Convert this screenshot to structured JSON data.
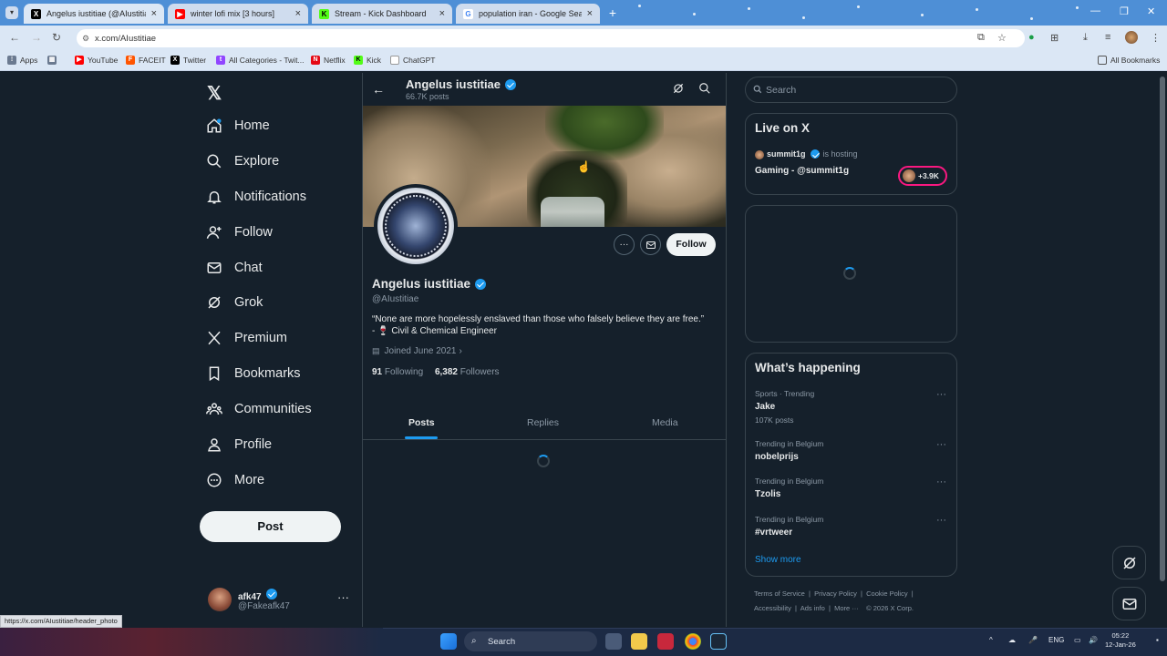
{
  "browser": {
    "tabs": [
      {
        "title": "Angelus iustitiae (@AIustitiae) /",
        "favicon": "x-logo-icon",
        "active": true
      },
      {
        "title": "winter lofi mix [3 hours] ",
        "favicon": "youtube-icon",
        "active": false
      },
      {
        "title": "Stream - Kick Dashboard",
        "favicon": "kick-icon",
        "active": false
      },
      {
        "title": "population iran - Google Searc",
        "favicon": "google-icon",
        "active": false
      }
    ],
    "url": "x.com/AIustitiae",
    "bookmarks": [
      {
        "label": "Apps",
        "icon": "apps-grid-icon"
      },
      {
        "label": "YouTube",
        "icon": "youtube-icon",
        "color": "#ff0000"
      },
      {
        "label": "FACEIT",
        "icon": "faceit-icon",
        "color": "#ff5500"
      },
      {
        "label": "Twitter",
        "icon": "x-logo-icon",
        "color": "#000000"
      },
      {
        "label": "All Categories - Twit...",
        "icon": "twitch-icon",
        "color": "#9146ff"
      },
      {
        "label": "Netflix",
        "icon": "netflix-icon",
        "color": "#e50914"
      },
      {
        "label": "Kick",
        "icon": "kick-icon",
        "color": "#53fc18"
      },
      {
        "label": "ChatGPT",
        "icon": "chatgpt-icon",
        "color": "#ffffff"
      }
    ],
    "all_bookmarks": "All Bookmarks",
    "status_link": "https://x.com/AIustitiae/header_photo"
  },
  "sidebar": {
    "items": [
      {
        "label": "Home",
        "icon": "home-icon"
      },
      {
        "label": "Explore",
        "icon": "search-icon"
      },
      {
        "label": "Notifications",
        "icon": "bell-icon"
      },
      {
        "label": "Follow",
        "icon": "follow-icon"
      },
      {
        "label": "Chat",
        "icon": "mail-icon"
      },
      {
        "label": "Grok",
        "icon": "grok-icon"
      },
      {
        "label": "Premium",
        "icon": "x-logo-icon"
      },
      {
        "label": "Bookmarks",
        "icon": "bookmark-icon"
      },
      {
        "label": "Communities",
        "icon": "communities-icon"
      },
      {
        "label": "Profile",
        "icon": "profile-icon"
      },
      {
        "label": "More",
        "icon": "more-circle-icon"
      }
    ],
    "post_label": "Post",
    "account": {
      "name": "afk47",
      "handle": "@Fakeafk47"
    }
  },
  "profile": {
    "header_name": "Angelus iustitiae",
    "header_posts": "66.7K posts",
    "name": "Angelus iustitiae",
    "handle": "@AIustitiae",
    "bio_line1": "“None are more hopelessly enslaved than those who falsely believe they are free.”",
    "bio_line2": "-  🍷 Civil & Chemical Engineer",
    "joined": "Joined June 2021",
    "following_count": "91",
    "following_label": "Following",
    "followers_count": "6,382",
    "followers_label": "Followers",
    "follow_button": "Follow",
    "tabs": [
      "Posts",
      "Replies",
      "Media"
    ]
  },
  "right": {
    "search_placeholder": "Search",
    "live": {
      "title": "Live on X",
      "user": "summit1g",
      "hosting": "is hosting",
      "stream_title": "Gaming - @summit1g",
      "viewers": "+3.9K"
    },
    "happening": {
      "title": "What’s happening",
      "trends": [
        {
          "context": "Sports · Trending",
          "name": "Jake",
          "count": "107K posts"
        },
        {
          "context": "Trending in Belgium",
          "name": "nobelprijs",
          "count": ""
        },
        {
          "context": "Trending in Belgium",
          "name": "Tzolis",
          "count": ""
        },
        {
          "context": "Trending in Belgium",
          "name": "#vrtweer",
          "count": ""
        }
      ],
      "show_more": "Show more"
    },
    "footer_line1": [
      "Terms of Service",
      "Privacy Policy",
      "Cookie Policy"
    ],
    "footer_line2": [
      "Accessibility",
      "Ads info",
      "More ···",
      "© 2026 X Corp."
    ]
  },
  "taskbar": {
    "search": "Search",
    "lang": "ENG",
    "time": "05:22",
    "date": "12-Jan-26"
  }
}
